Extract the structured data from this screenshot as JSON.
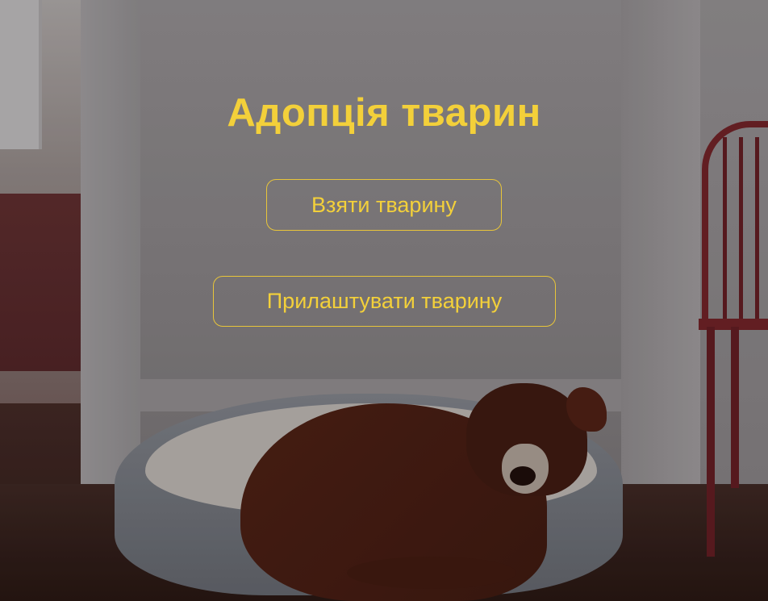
{
  "hero": {
    "title": "Адопція тварин",
    "buttons": {
      "take_label": "Взяти тварину",
      "give_label": "Прилаштувати тварину"
    },
    "accent_color": "#f3d03a"
  }
}
